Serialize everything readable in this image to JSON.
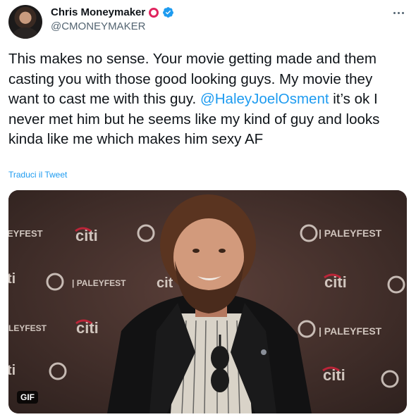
{
  "author": {
    "display_name": "Chris Moneymaker",
    "handle": "@CMONEYMAKER",
    "ring_color": "#e0245e",
    "verified_color": "#1d9bf0"
  },
  "tweet": {
    "text_part1": "This makes no sense. Your movie getting made and them casting you with those good looking guys. My movie they want to cast me with this guy. ",
    "mention": "@HaleyJoelOsment",
    "text_part2": " it’s ok I never met him but he seems like my kind of guy and looks kinda like me which makes him sexy AF",
    "translate_label": "Traduci il Tweet"
  },
  "media": {
    "type": "gif",
    "badge": "GIF",
    "backdrop_words": [
      "citi",
      "PALEYFEST"
    ]
  },
  "colors": {
    "text": "#0f1419",
    "secondary": "#536471",
    "link": "#1d9bf0"
  },
  "icons": [
    "avatar",
    "red-ring-icon",
    "verified-icon",
    "more-icon"
  ]
}
